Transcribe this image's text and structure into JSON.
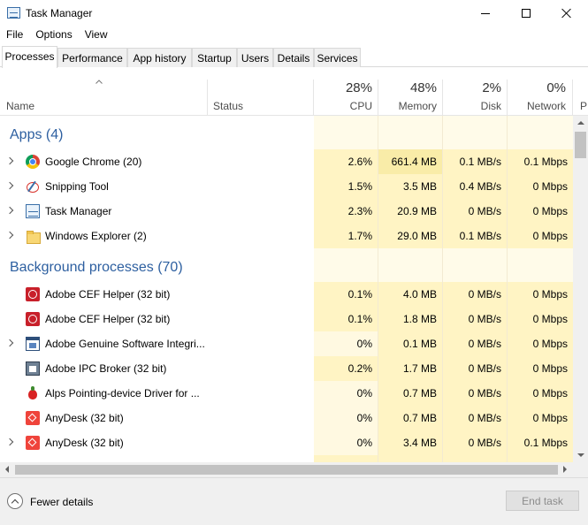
{
  "window": {
    "title": "Task Manager"
  },
  "menu": [
    "File",
    "Options",
    "View"
  ],
  "tabs": [
    "Processes",
    "Performance",
    "App history",
    "Startup",
    "Users",
    "Details",
    "Services"
  ],
  "active_tab": "Processes",
  "columns": {
    "name": "Name",
    "status": "Status",
    "cpu": {
      "pct": "28%",
      "label": "CPU"
    },
    "memory": {
      "pct": "48%",
      "label": "Memory"
    },
    "disk": {
      "pct": "2%",
      "label": "Disk"
    },
    "network": {
      "pct": "0%",
      "label": "Network"
    },
    "cut_label": "P"
  },
  "groups": [
    {
      "label": "Apps (4)"
    },
    {
      "label": "Background processes (70)"
    }
  ],
  "apps": [
    {
      "name": "Google Chrome (20)",
      "cpu": "2.6%",
      "memory": "661.4 MB",
      "disk": "0.1 MB/s",
      "network": "0.1 Mbps",
      "icon": "chrome-icon"
    },
    {
      "name": "Snipping Tool",
      "cpu": "1.5%",
      "memory": "3.5 MB",
      "disk": "0.4 MB/s",
      "network": "0 Mbps",
      "icon": "snipping-tool-icon"
    },
    {
      "name": "Task Manager",
      "cpu": "2.3%",
      "memory": "20.9 MB",
      "disk": "0 MB/s",
      "network": "0 Mbps",
      "icon": "task-manager-icon"
    },
    {
      "name": "Windows Explorer (2)",
      "cpu": "1.7%",
      "memory": "29.0 MB",
      "disk": "0.1 MB/s",
      "network": "0 Mbps",
      "icon": "folder-icon"
    }
  ],
  "background": [
    {
      "name": "Adobe CEF Helper (32 bit)",
      "cpu": "0.1%",
      "memory": "4.0 MB",
      "disk": "0 MB/s",
      "network": "0 Mbps",
      "icon": "adobe-icon"
    },
    {
      "name": "Adobe CEF Helper (32 bit)",
      "cpu": "0.1%",
      "memory": "1.8 MB",
      "disk": "0 MB/s",
      "network": "0 Mbps",
      "icon": "adobe-icon"
    },
    {
      "name": "Adobe Genuine Software Integri...",
      "cpu": "0%",
      "memory": "0.1 MB",
      "disk": "0 MB/s",
      "network": "0 Mbps",
      "icon": "window-icon"
    },
    {
      "name": "Adobe IPC Broker (32 bit)",
      "cpu": "0.2%",
      "memory": "1.7 MB",
      "disk": "0 MB/s",
      "network": "0 Mbps",
      "icon": "broker-icon"
    },
    {
      "name": "Alps Pointing-device Driver for ...",
      "cpu": "0%",
      "memory": "0.7 MB",
      "disk": "0 MB/s",
      "network": "0 Mbps",
      "icon": "alps-icon"
    },
    {
      "name": "AnyDesk (32 bit)",
      "cpu": "0%",
      "memory": "0.7 MB",
      "disk": "0 MB/s",
      "network": "0 Mbps",
      "icon": "anydesk-icon"
    },
    {
      "name": "AnyDesk (32 bit)",
      "cpu": "0%",
      "memory": "3.4 MB",
      "disk": "0 MB/s",
      "network": "0.1 Mbps",
      "icon": "anydesk-icon"
    }
  ],
  "footer": {
    "fewer_details": "Fewer details",
    "end_task": "End task"
  },
  "colors": {
    "group_text": "#2d5fa0",
    "heat_light": "#fff4c4",
    "heat_medium": "#f9eca8"
  }
}
